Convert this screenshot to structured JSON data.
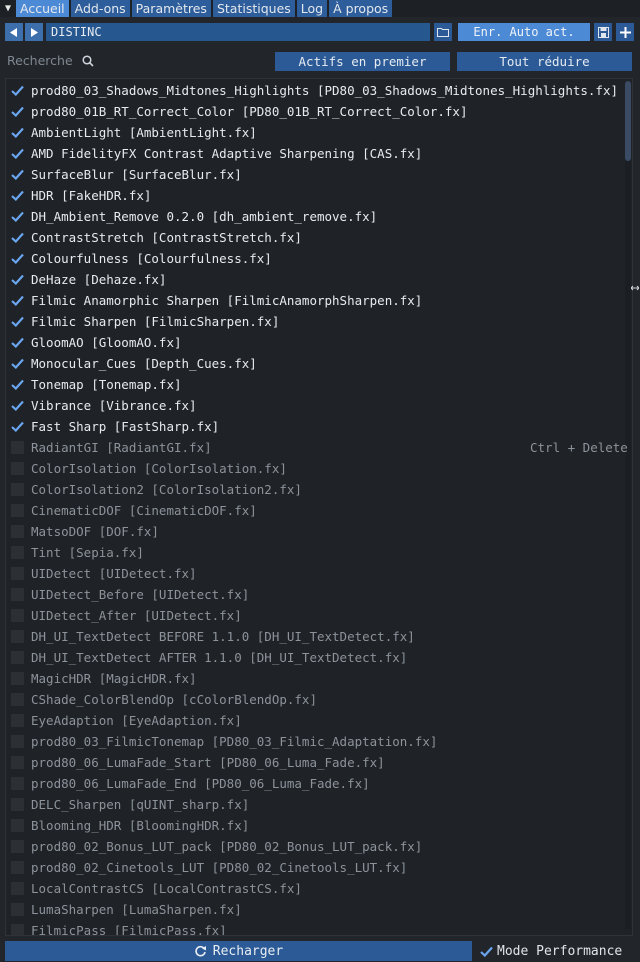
{
  "tabs": [
    "Accueil",
    "Add-ons",
    "Paramètres",
    "Statistiques",
    "Log",
    "À propos"
  ],
  "preset": {
    "name": "DISTINC",
    "autosave_label": "Enr. Auto act."
  },
  "search": {
    "label": "Recherche",
    "active_first_label": "Actifs en premier",
    "collapse_all_label": "Tout réduire"
  },
  "effects": [
    {
      "label": "prod80_03_Shadows_Midtones_Highlights [PD80_03_Shadows_Midtones_Highlights.fx]",
      "enabled": true
    },
    {
      "label": "prod80_01B_RT_Correct_Color [PD80_01B_RT_Correct_Color.fx]",
      "enabled": true
    },
    {
      "label": "AmbientLight [AmbientLight.fx]",
      "enabled": true
    },
    {
      "label": "AMD FidelityFX Contrast Adaptive Sharpening [CAS.fx]",
      "enabled": true
    },
    {
      "label": "SurfaceBlur [SurfaceBlur.fx]",
      "enabled": true
    },
    {
      "label": "HDR [FakeHDR.fx]",
      "enabled": true
    },
    {
      "label": "DH_Ambient_Remove 0.2.0 [dh_ambient_remove.fx]",
      "enabled": true
    },
    {
      "label": "ContrastStretch [ContrastStretch.fx]",
      "enabled": true
    },
    {
      "label": "Colourfulness [Colourfulness.fx]",
      "enabled": true
    },
    {
      "label": "DeHaze [Dehaze.fx]",
      "enabled": true
    },
    {
      "label": "Filmic Anamorphic Sharpen [FilmicAnamorphSharpen.fx]",
      "enabled": true
    },
    {
      "label": "Filmic Sharpen [FilmicSharpen.fx]",
      "enabled": true
    },
    {
      "label": "GloomAO [GloomAO.fx]",
      "enabled": true
    },
    {
      "label": "Monocular_Cues [Depth_Cues.fx]",
      "enabled": true
    },
    {
      "label": "Tonemap [Tonemap.fx]",
      "enabled": true
    },
    {
      "label": "Vibrance [Vibrance.fx]",
      "enabled": true
    },
    {
      "label": "Fast Sharp [FastSharp.fx]",
      "enabled": true
    },
    {
      "label": "RadiantGI [RadiantGI.fx]",
      "enabled": false,
      "shortcut": "Ctrl + Delete"
    },
    {
      "label": "ColorIsolation [ColorIsolation.fx]",
      "enabled": false
    },
    {
      "label": "ColorIsolation2 [ColorIsolation2.fx]",
      "enabled": false
    },
    {
      "label": "CinematicDOF [CinematicDOF.fx]",
      "enabled": false
    },
    {
      "label": "MatsoDOF [DOF.fx]",
      "enabled": false
    },
    {
      "label": "Tint [Sepia.fx]",
      "enabled": false
    },
    {
      "label": "UIDetect [UIDetect.fx]",
      "enabled": false
    },
    {
      "label": "UIDetect_Before [UIDetect.fx]",
      "enabled": false
    },
    {
      "label": "UIDetect_After [UIDetect.fx]",
      "enabled": false
    },
    {
      "label": "DH_UI_TextDetect BEFORE 1.1.0 [DH_UI_TextDetect.fx]",
      "enabled": false
    },
    {
      "label": "DH_UI_TextDetect AFTER 1.1.0 [DH_UI_TextDetect.fx]",
      "enabled": false
    },
    {
      "label": "MagicHDR [MagicHDR.fx]",
      "enabled": false
    },
    {
      "label": "CShade_ColorBlendOp [cColorBlendOp.fx]",
      "enabled": false
    },
    {
      "label": "EyeAdaption [EyeAdaption.fx]",
      "enabled": false
    },
    {
      "label": "prod80_03_FilmicTonemap [PD80_03_Filmic_Adaptation.fx]",
      "enabled": false
    },
    {
      "label": "prod80_06_LumaFade_Start [PD80_06_Luma_Fade.fx]",
      "enabled": false
    },
    {
      "label": "prod80_06_LumaFade_End [PD80_06_Luma_Fade.fx]",
      "enabled": false
    },
    {
      "label": "DELC_Sharpen [qUINT_sharp.fx]",
      "enabled": false
    },
    {
      "label": "Blooming_HDR [BloomingHDR.fx]",
      "enabled": false
    },
    {
      "label": "prod80_02_Bonus_LUT_pack [PD80_02_Bonus_LUT_pack.fx]",
      "enabled": false
    },
    {
      "label": "prod80_02_Cinetools_LUT [PD80_02_Cinetools_LUT.fx]",
      "enabled": false
    },
    {
      "label": "LocalContrastCS [LocalContrastCS.fx]",
      "enabled": false
    },
    {
      "label": "LumaSharpen [LumaSharpen.fx]",
      "enabled": false
    },
    {
      "label": "FilmicPass [FilmicPass.fx]",
      "enabled": false
    }
  ],
  "bottom": {
    "reload_label": "Recharger",
    "performance_label": "Mode Performance",
    "performance_enabled": true
  },
  "colors": {
    "accent": "#4d8ad6",
    "button": "#2b5a96",
    "check": "#6aa6f0"
  }
}
